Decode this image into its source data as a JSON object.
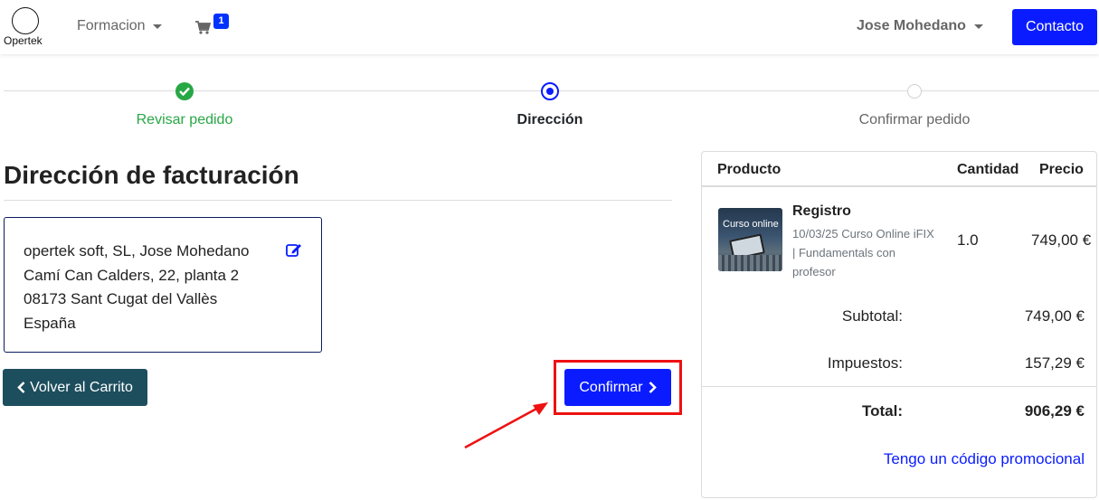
{
  "navbar": {
    "logo_text": "Opertek",
    "formacion_label": "Formacion",
    "cart_count": "1",
    "user_name": "Jose Mohedano",
    "contact_label": "Contacto"
  },
  "steps": [
    {
      "label": "Revisar pedido",
      "state": "done"
    },
    {
      "label": "Dirección",
      "state": "active"
    },
    {
      "label": "Confirmar pedido",
      "state": "pending"
    }
  ],
  "billing": {
    "title": "Dirección de facturación",
    "address_lines": [
      "opertek soft, SL, Jose Mohedano",
      "Camí Can Calders, 22, planta 2",
      "08173 Sant Cugat del Vallès",
      "España"
    ]
  },
  "actions": {
    "back_label": "Volver al Carrito",
    "confirm_label": "Confirmar"
  },
  "summary": {
    "headers": {
      "product": "Producto",
      "quantity": "Cantidad",
      "price": "Precio"
    },
    "item": {
      "thumb_label": "Curso online",
      "name": "Registro",
      "description": "10/03/25 Curso Online iFIX | Fundamentals con profesor",
      "quantity": "1.0",
      "price": "749,00 €"
    },
    "subtotal_label": "Subtotal:",
    "subtotal_value": "749,00 €",
    "tax_label": "Impuestos:",
    "tax_value": "157,29 €",
    "total_label": "Total:",
    "total_value": "906,29 €",
    "promo_link": "Tengo un código promocional"
  },
  "colors": {
    "primary": "#0a1cff",
    "success": "#28a745",
    "back_button": "#1d4e5e",
    "highlight": "#ee1111"
  }
}
